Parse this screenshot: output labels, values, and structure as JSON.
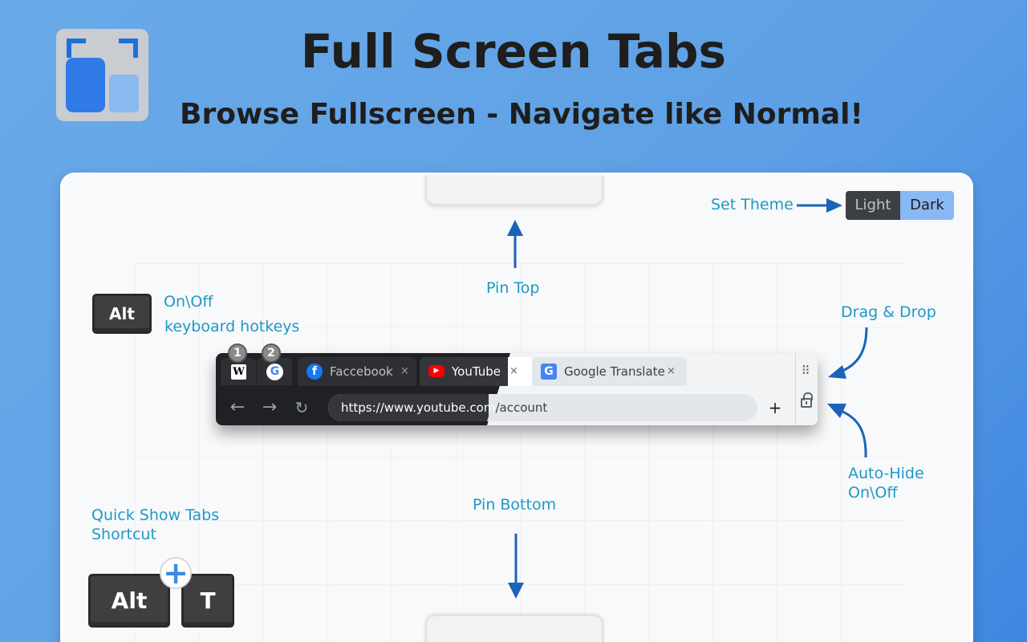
{
  "header": {
    "title": "Full Screen Tabs",
    "subtitle": "Browse Fullscreen - Navigate like Normal!"
  },
  "labels": {
    "set_theme": "Set Theme",
    "pin_top": "Pin Top",
    "pin_bottom": "Pin Bottom",
    "on_off": "On\\Off",
    "keyboard_hotkeys": "keyboard hotkeys",
    "drag_drop": "Drag & Drop",
    "auto_hide": "Auto-Hide",
    "auto_hide_on_off": "On\\Off",
    "quick_show_tabs": "Quick Show Tabs",
    "shortcut": "Shortcut"
  },
  "theme": {
    "light": "Light",
    "dark": "Dark"
  },
  "keys": {
    "alt": "Alt",
    "alt2": "Alt",
    "t": "T",
    "plus": "+"
  },
  "browser": {
    "pinned_tabs": [
      {
        "badge": "1",
        "icon": "wikipedia-icon",
        "glyph": "W"
      },
      {
        "badge": "2",
        "icon": "google-icon",
        "glyph": "G"
      }
    ],
    "tabs": [
      {
        "label": "Faccebook",
        "icon": "facebook-icon",
        "glyph": "f",
        "close": "×"
      },
      {
        "label": "YouTube",
        "icon": "youtube-icon",
        "glyph": "▶",
        "close": "×"
      },
      {
        "label": "Google Translate",
        "icon": "google-translate-icon",
        "glyph": "G",
        "close": "×"
      }
    ],
    "nav": {
      "back": "←",
      "forward": "→",
      "reload": "↻"
    },
    "url_part1": "https://www.youtube.com",
    "url_part2": "/account",
    "new_tab": "+",
    "drag_handle": "⠿"
  },
  "colors": {
    "accent_label": "#1f98c8",
    "arrow": "#1a63b8",
    "background": "#5ea0e6"
  }
}
